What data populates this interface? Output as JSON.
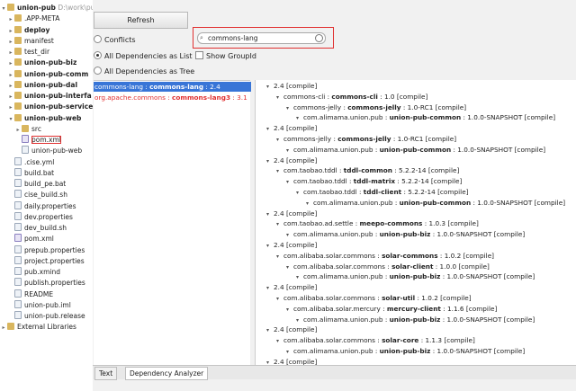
{
  "project_tree": {
    "items": [
      {
        "label": "union-pub",
        "suffix": "D:\\work\\pu",
        "type": "folder",
        "indent": 0,
        "arrow": "▾",
        "bold": true
      },
      {
        "label": ".APP-META",
        "type": "folder",
        "indent": 1,
        "arrow": "▸"
      },
      {
        "label": "deploy",
        "type": "folder",
        "indent": 1,
        "arrow": "▸",
        "bold": true
      },
      {
        "label": "manifest",
        "type": "folder",
        "indent": 1,
        "arrow": "▸"
      },
      {
        "label": "test_dir",
        "type": "folder",
        "indent": 1,
        "arrow": "▸"
      },
      {
        "label": "union-pub-biz",
        "type": "folder",
        "indent": 1,
        "arrow": "▸",
        "bold": true
      },
      {
        "label": "union-pub-comm",
        "type": "folder",
        "indent": 1,
        "arrow": "▸",
        "bold": true
      },
      {
        "label": "union-pub-dal",
        "type": "folder",
        "indent": 1,
        "arrow": "▸",
        "bold": true
      },
      {
        "label": "union-pub-interfa",
        "type": "folder",
        "indent": 1,
        "arrow": "▸",
        "bold": true
      },
      {
        "label": "union-pub-service",
        "type": "folder",
        "indent": 1,
        "arrow": "▸",
        "bold": true
      },
      {
        "label": "union-pub-web",
        "type": "folder",
        "indent": 1,
        "arrow": "▾",
        "bold": true
      },
      {
        "label": "src",
        "type": "folder",
        "indent": 2,
        "arrow": "▸"
      },
      {
        "label": "pom.xml",
        "type": "mfile",
        "indent": 2,
        "arrow": "",
        "selected": true
      },
      {
        "label": "union-pub-web",
        "type": "file",
        "indent": 2,
        "arrow": ""
      },
      {
        "label": ".cise.yml",
        "type": "file",
        "indent": 1,
        "arrow": ""
      },
      {
        "label": "build.bat",
        "type": "file",
        "indent": 1,
        "arrow": ""
      },
      {
        "label": "build_pe.bat",
        "type": "file",
        "indent": 1,
        "arrow": ""
      },
      {
        "label": "cise_build.sh",
        "type": "file",
        "indent": 1,
        "arrow": ""
      },
      {
        "label": "daily.properties",
        "type": "file",
        "indent": 1,
        "arrow": ""
      },
      {
        "label": "dev.properties",
        "type": "file",
        "indent": 1,
        "arrow": ""
      },
      {
        "label": "dev_build.sh",
        "type": "file",
        "indent": 1,
        "arrow": ""
      },
      {
        "label": "pom.xml",
        "type": "mfile",
        "indent": 1,
        "arrow": ""
      },
      {
        "label": "prepub.properties",
        "type": "file",
        "indent": 1,
        "arrow": ""
      },
      {
        "label": "project.properties",
        "type": "file",
        "indent": 1,
        "arrow": ""
      },
      {
        "label": "pub.xmind",
        "type": "file",
        "indent": 1,
        "arrow": ""
      },
      {
        "label": "publish.properties",
        "type": "file",
        "indent": 1,
        "arrow": ""
      },
      {
        "label": "README",
        "type": "file",
        "indent": 1,
        "arrow": ""
      },
      {
        "label": "union-pub.iml",
        "type": "file",
        "indent": 1,
        "arrow": ""
      },
      {
        "label": "union-pub.release",
        "type": "file",
        "indent": 1,
        "arrow": ""
      },
      {
        "label": "External Libraries",
        "type": "folder",
        "indent": 0,
        "arrow": "▸"
      }
    ]
  },
  "toolbar": {
    "refresh_label": "Refresh"
  },
  "options": {
    "conflicts": "Conflicts",
    "all_list": "All Dependencies as List",
    "show_groupid": "Show GroupId",
    "all_tree": "All Dependencies as Tree"
  },
  "search": {
    "value": "commons-lang",
    "icon": "search-icon"
  },
  "results": [
    {
      "group": "commons-lang",
      "artifact": "commons-lang",
      "version": "2.4",
      "selected": true
    },
    {
      "group": "org.apache.commons",
      "artifact": "commons-lang3",
      "version": "3.1",
      "red": true
    }
  ],
  "dependency_tree": [
    {
      "level": 0,
      "text": "2.4 [compile]"
    },
    {
      "level": 1,
      "pre": "commons-cli : ",
      "bold": "commons-cli",
      "post": " : 1.0 [compile]"
    },
    {
      "level": 2,
      "pre": "commons-jelly : ",
      "bold": "commons-jelly",
      "post": " : 1.0-RC1 [compile]"
    },
    {
      "level": 3,
      "pre": "com.alimama.union.pub : ",
      "bold": "union-pub-common",
      "post": " : 1.0.0-SNAPSHOT [compile]"
    },
    {
      "level": 0,
      "text": "2.4 [compile]"
    },
    {
      "level": 1,
      "pre": "commons-jelly : ",
      "bold": "commons-jelly",
      "post": " : 1.0-RC1 [compile]"
    },
    {
      "level": 2,
      "pre": "com.alimama.union.pub : ",
      "bold": "union-pub-common",
      "post": " : 1.0.0-SNAPSHOT [compile]"
    },
    {
      "level": 0,
      "text": "2.4 [compile]"
    },
    {
      "level": 1,
      "pre": "com.taobao.tddl : ",
      "bold": "tddl-common",
      "post": " : 5.2.2-14 [compile]"
    },
    {
      "level": 2,
      "pre": "com.taobao.tddl : ",
      "bold": "tddl-matrix",
      "post": " : 5.2.2-14 [compile]"
    },
    {
      "level": 3,
      "pre": "com.taobao.tddl : ",
      "bold": "tddl-client",
      "post": " : 5.2.2-14 [compile]"
    },
    {
      "level": 4,
      "pre": "com.alimama.union.pub : ",
      "bold": "union-pub-common",
      "post": " : 1.0.0-SNAPSHOT [compile]"
    },
    {
      "level": 0,
      "text": "2.4 [compile]"
    },
    {
      "level": 1,
      "pre": "com.taobao.ad.settle : ",
      "bold": "meepo-commons",
      "post": " : 1.0.3 [compile]"
    },
    {
      "level": 2,
      "pre": "com.alimama.union.pub : ",
      "bold": "union-pub-biz",
      "post": " : 1.0.0-SNAPSHOT [compile]"
    },
    {
      "level": 0,
      "text": "2.4 [compile]"
    },
    {
      "level": 1,
      "pre": "com.alibaba.solar.commons : ",
      "bold": "solar-commons",
      "post": " : 1.0.2 [compile]"
    },
    {
      "level": 2,
      "pre": "com.alibaba.solar.commons : ",
      "bold": "solar-client",
      "post": " : 1.0.0 [compile]"
    },
    {
      "level": 3,
      "pre": "com.alimama.union.pub : ",
      "bold": "union-pub-biz",
      "post": " : 1.0.0-SNAPSHOT [compile]"
    },
    {
      "level": 0,
      "text": "2.4 [compile]"
    },
    {
      "level": 1,
      "pre": "com.alibaba.solar.commons : ",
      "bold": "solar-util",
      "post": " : 1.0.2 [compile]"
    },
    {
      "level": 2,
      "pre": "com.alibaba.solar.mercury : ",
      "bold": "mercury-client",
      "post": " : 1.1.6 [compile]"
    },
    {
      "level": 3,
      "pre": "com.alimama.union.pub : ",
      "bold": "union-pub-biz",
      "post": " : 1.0.0-SNAPSHOT [compile]"
    },
    {
      "level": 0,
      "text": "2.4 [compile]"
    },
    {
      "level": 1,
      "pre": "com.alibaba.solar.commons : ",
      "bold": "solar-core",
      "post": " : 1.1.3 [compile]"
    },
    {
      "level": 2,
      "pre": "com.alimama.union.pub : ",
      "bold": "union-pub-biz",
      "post": " : 1.0.0-SNAPSHOT [compile]"
    },
    {
      "level": 0,
      "text": "2.4 [compile]"
    }
  ],
  "tabs": [
    {
      "label": "Text",
      "active": false
    },
    {
      "label": "Dependency Analyzer",
      "active": true
    }
  ]
}
